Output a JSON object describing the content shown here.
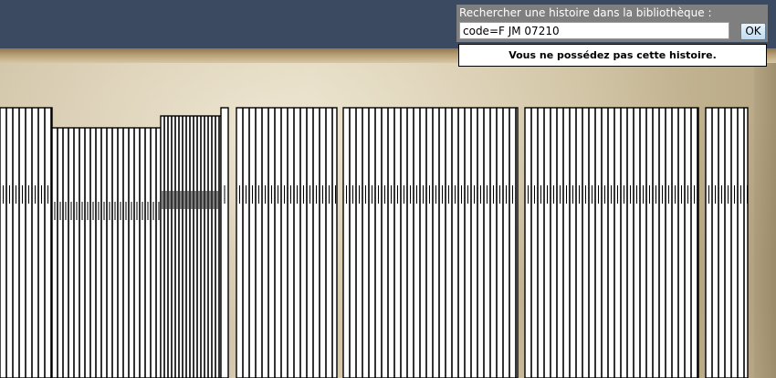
{
  "search": {
    "label": "Rechercher une histoire dans la bibliothèque :",
    "value": "code=F JM 07210",
    "button_label": "OK"
  },
  "result": {
    "message": "Vous ne possédez pas cette histoire."
  },
  "colors": {
    "header": "#3b4a60",
    "search_panel": "#7f7f7f",
    "book_spine": "#ffffff",
    "spine_lines": "#000000"
  }
}
